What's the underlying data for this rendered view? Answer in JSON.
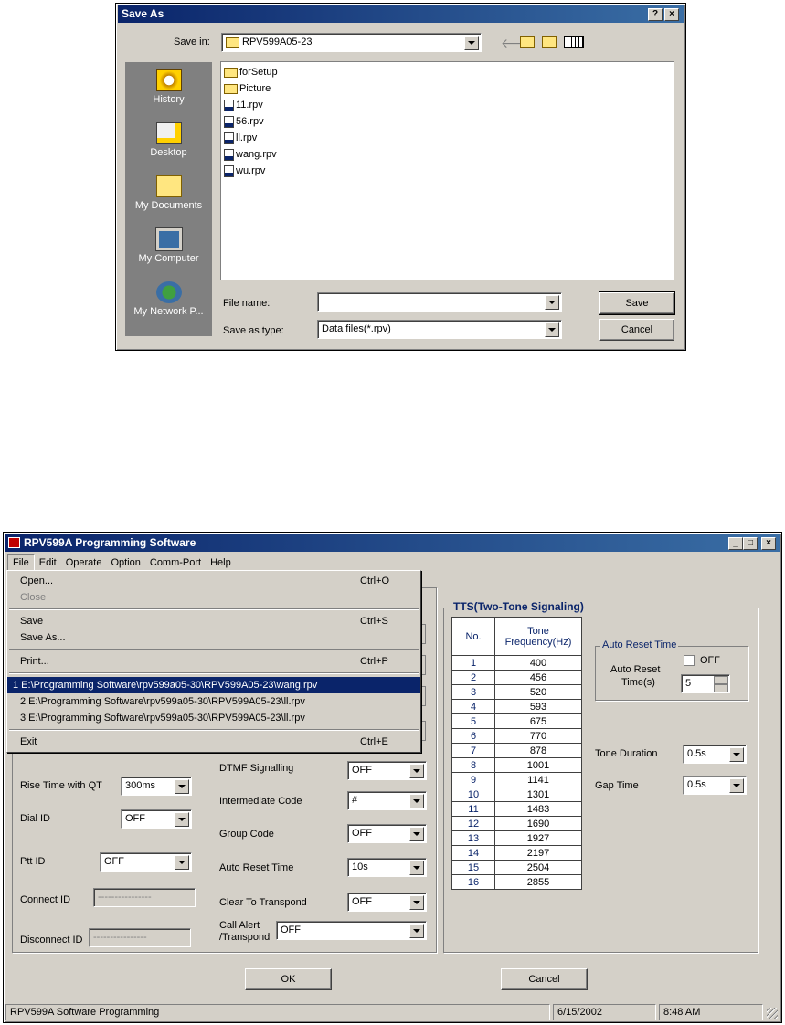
{
  "save_dialog": {
    "title": "Save As",
    "help_btn": "?",
    "close_btn": "×",
    "save_in_label": "Save in:",
    "save_in_value": "RPV599A05-23",
    "places": [
      "History",
      "Desktop",
      "My Documents",
      "My Computer",
      "My Network P..."
    ],
    "files": [
      {
        "name": "forSetup",
        "type": "folder"
      },
      {
        "name": "Picture",
        "type": "folder"
      },
      {
        "name": "11.rpv",
        "type": "file"
      },
      {
        "name": "56.rpv",
        "type": "file"
      },
      {
        "name": "ll.rpv",
        "type": "file"
      },
      {
        "name": "wang.rpv",
        "type": "file"
      },
      {
        "name": "wu.rpv",
        "type": "file"
      }
    ],
    "file_name_label": "File name:",
    "file_name_value": "",
    "save_type_label": "Save as type:",
    "save_type_value": "Data files(*.rpv)",
    "save_btn": "Save",
    "cancel_btn": "Cancel"
  },
  "app": {
    "title": "RPV599A Programming Software",
    "menubar": [
      "File",
      "Edit",
      "Operate",
      "Option",
      "Comm-Port",
      "Help"
    ],
    "file_menu": [
      {
        "label": "Open...",
        "shortcut": "Ctrl+O"
      },
      {
        "label": "Close",
        "shortcut": "",
        "disabled": true
      },
      {
        "sep": true
      },
      {
        "label": "Save",
        "shortcut": "Ctrl+S"
      },
      {
        "label": "Save As...",
        "shortcut": ""
      },
      {
        "sep": true
      },
      {
        "label": "Print...",
        "shortcut": "Ctrl+P"
      },
      {
        "sep": true
      },
      {
        "label": "1 E:\\Programming Software\\rpv599a05-30\\RPV599A05-23\\wang.rpv",
        "shortcut": "",
        "highlight": true
      },
      {
        "label": "2 E:\\Programming Software\\rpv599a05-30\\RPV599A05-23\\ll.rpv",
        "shortcut": ""
      },
      {
        "label": "3 E:\\Programming Software\\rpv599a05-30\\RPV599A05-23\\ll.rpv",
        "shortcut": ""
      },
      {
        "sep": true
      },
      {
        "label": "Exit",
        "shortcut": "Ctrl+E"
      }
    ],
    "left": {
      "rise_time_label": "Rise Time with QT",
      "rise_time_value": "300ms",
      "dial_id_label": "Dial ID",
      "dial_id_value": "OFF",
      "ptt_id_label": "Ptt ID",
      "ptt_id_value": "OFF",
      "connect_id_label": "Connect ID",
      "connect_id_value": "----------------",
      "disconnect_id_label": "Disconnect ID",
      "disconnect_id_value": "----------------"
    },
    "mid": {
      "dtmf_label": "DTMF Signalling",
      "dtmf_value": "OFF",
      "intermediate_label": "Intermediate Code",
      "intermediate_value": "#",
      "group_label": "Group Code",
      "group_value": "OFF",
      "auto_reset_label": "Auto Reset Time",
      "auto_reset_value": "10s",
      "clear_label": "Clear To Transpond",
      "clear_value": "OFF",
      "call_alert_label1": "Call Alert",
      "call_alert_label2": "/Transpond",
      "call_alert_value": "OFF"
    },
    "tts": {
      "title": "TTS(Two-Tone Signaling)",
      "col_no": "No.",
      "col_freq1": "Tone",
      "col_freq2": "Frequency(Hz)",
      "rows": [
        [
          "1",
          "400"
        ],
        [
          "2",
          "456"
        ],
        [
          "3",
          "520"
        ],
        [
          "4",
          "593"
        ],
        [
          "5",
          "675"
        ],
        [
          "6",
          "770"
        ],
        [
          "7",
          "878"
        ],
        [
          "8",
          "1001"
        ],
        [
          "9",
          "1141"
        ],
        [
          "10",
          "1301"
        ],
        [
          "11",
          "1483"
        ],
        [
          "12",
          "1690"
        ],
        [
          "13",
          "1927"
        ],
        [
          "14",
          "2197"
        ],
        [
          "15",
          "2504"
        ],
        [
          "16",
          "2855"
        ]
      ],
      "auto_reset_group": "Auto Reset Time",
      "auto_reset_label1": "Auto Reset",
      "auto_reset_label2": "Time(s)",
      "off_label": "OFF",
      "auto_reset_value": "5",
      "tone_duration_label": "Tone Duration",
      "tone_duration_value": "0.5s",
      "gap_time_label": "Gap Time",
      "gap_time_value": "0.5s"
    },
    "ok_btn": "OK",
    "cancel_btn": "Cancel",
    "status": {
      "left": "RPV599A Software Programming",
      "date": "6/15/2002",
      "time": "8:48 AM"
    }
  }
}
